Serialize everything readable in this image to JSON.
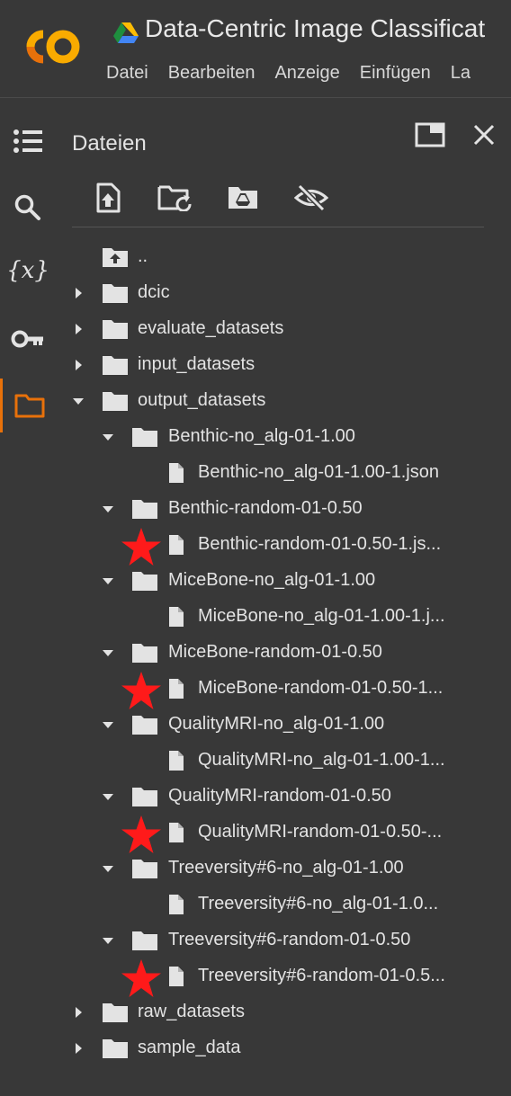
{
  "app": {
    "title": "Data-Centric Image Classificat",
    "menu": [
      "Datei",
      "Bearbeiten",
      "Anzeige",
      "Einfügen",
      "La"
    ]
  },
  "sidebar": {
    "items": [
      {
        "name": "table-of-contents-icon"
      },
      {
        "name": "search-icon"
      },
      {
        "name": "variables-icon",
        "text": "{x}"
      },
      {
        "name": "secrets-key-icon"
      },
      {
        "name": "files-folder-icon",
        "active": true
      }
    ]
  },
  "files_panel": {
    "title": "Dateien",
    "toolbar": [
      "upload-file-icon",
      "refresh-folder-icon",
      "mount-drive-icon",
      "hide-files-icon"
    ],
    "tree": [
      {
        "label": "..",
        "type": "up",
        "depth": 0
      },
      {
        "label": "dcic",
        "type": "folder",
        "depth": 0,
        "expanded": false
      },
      {
        "label": "evaluate_datasets",
        "type": "folder",
        "depth": 0,
        "expanded": false
      },
      {
        "label": "input_datasets",
        "type": "folder",
        "depth": 0,
        "expanded": false
      },
      {
        "label": "output_datasets",
        "type": "folder",
        "depth": 0,
        "expanded": true
      },
      {
        "label": "Benthic-no_alg-01-1.00",
        "type": "folder",
        "depth": 1,
        "expanded": true
      },
      {
        "label": "Benthic-no_alg-01-1.00-1.json",
        "type": "file",
        "depth": 2,
        "starred": false
      },
      {
        "label": "Benthic-random-01-0.50",
        "type": "folder",
        "depth": 1,
        "expanded": true
      },
      {
        "label": "Benthic-random-01-0.50-1.js...",
        "type": "file",
        "depth": 2,
        "starred": true
      },
      {
        "label": "MiceBone-no_alg-01-1.00",
        "type": "folder",
        "depth": 1,
        "expanded": true
      },
      {
        "label": "MiceBone-no_alg-01-1.00-1.j...",
        "type": "file",
        "depth": 2,
        "starred": false
      },
      {
        "label": "MiceBone-random-01-0.50",
        "type": "folder",
        "depth": 1,
        "expanded": true
      },
      {
        "label": "MiceBone-random-01-0.50-1...",
        "type": "file",
        "depth": 2,
        "starred": true
      },
      {
        "label": "QualityMRI-no_alg-01-1.00",
        "type": "folder",
        "depth": 1,
        "expanded": true
      },
      {
        "label": "QualityMRI-no_alg-01-1.00-1...",
        "type": "file",
        "depth": 2,
        "starred": false
      },
      {
        "label": "QualityMRI-random-01-0.50",
        "type": "folder",
        "depth": 1,
        "expanded": true
      },
      {
        "label": "QualityMRI-random-01-0.50-...",
        "type": "file",
        "depth": 2,
        "starred": true
      },
      {
        "label": "Treeversity#6-no_alg-01-1.00",
        "type": "folder",
        "depth": 1,
        "expanded": true
      },
      {
        "label": "Treeversity#6-no_alg-01-1.0...",
        "type": "file",
        "depth": 2,
        "starred": false
      },
      {
        "label": "Treeversity#6-random-01-0.50",
        "type": "folder",
        "depth": 1,
        "expanded": true
      },
      {
        "label": "Treeversity#6-random-01-0.5...",
        "type": "file",
        "depth": 2,
        "starred": true
      },
      {
        "label": "raw_datasets",
        "type": "folder",
        "depth": 0,
        "expanded": false
      },
      {
        "label": "sample_data",
        "type": "folder",
        "depth": 0,
        "expanded": false
      }
    ]
  },
  "colors": {
    "background": "#383838",
    "accent": "#e8710a",
    "star": "#ff1a1a",
    "logo_orange": "#f9ab00",
    "logo_dark_orange": "#e8710a"
  }
}
